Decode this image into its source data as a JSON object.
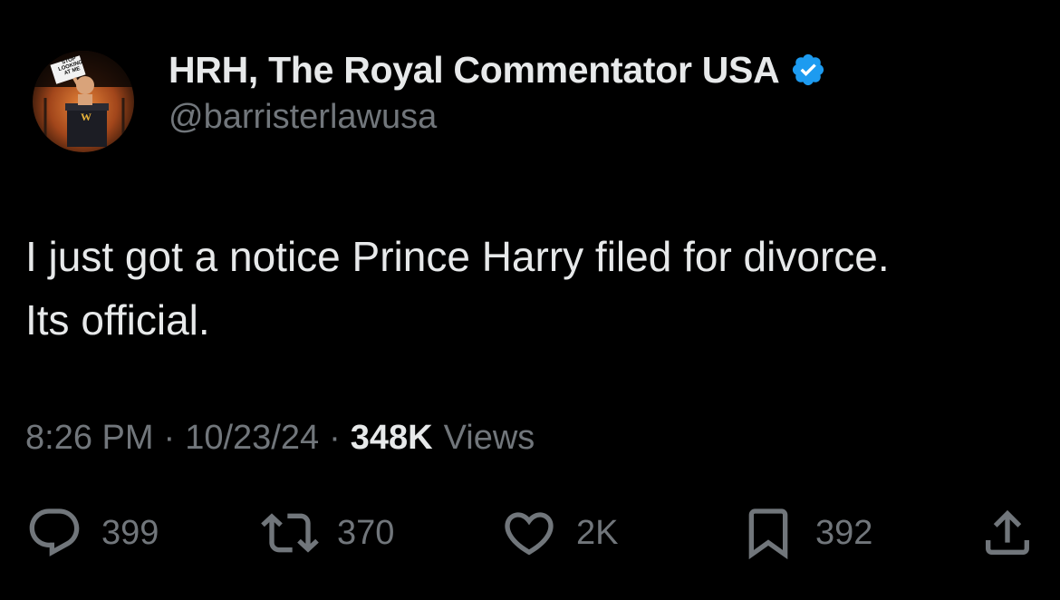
{
  "author": {
    "display_name": "HRH, The Royal Commentator USA",
    "handle": "@barristerlawusa",
    "verified_icon": "verified-badge-icon",
    "avatar_sign_text": "STOP LOOKING AT ME",
    "avatar_podium_letter": "W"
  },
  "tweet": {
    "lines": [
      "I just got a notice Prince Harry filed for divorce.",
      "Its official."
    ]
  },
  "meta": {
    "time": "8:26 PM",
    "separator": "·",
    "date": "10/23/24",
    "views_count": "348K",
    "views_label": "Views"
  },
  "actions": {
    "reply": {
      "icon": "reply-icon",
      "count": "399"
    },
    "retweet": {
      "icon": "retweet-icon",
      "count": "370"
    },
    "like": {
      "icon": "heart-icon",
      "count": "2K"
    },
    "bookmark": {
      "icon": "bookmark-icon",
      "count": "392"
    },
    "share": {
      "icon": "share-icon"
    }
  },
  "colors": {
    "background": "#000000",
    "primary_text": "#e7e9ea",
    "secondary_text": "#71767b",
    "verified_blue": "#1d9bf0"
  }
}
